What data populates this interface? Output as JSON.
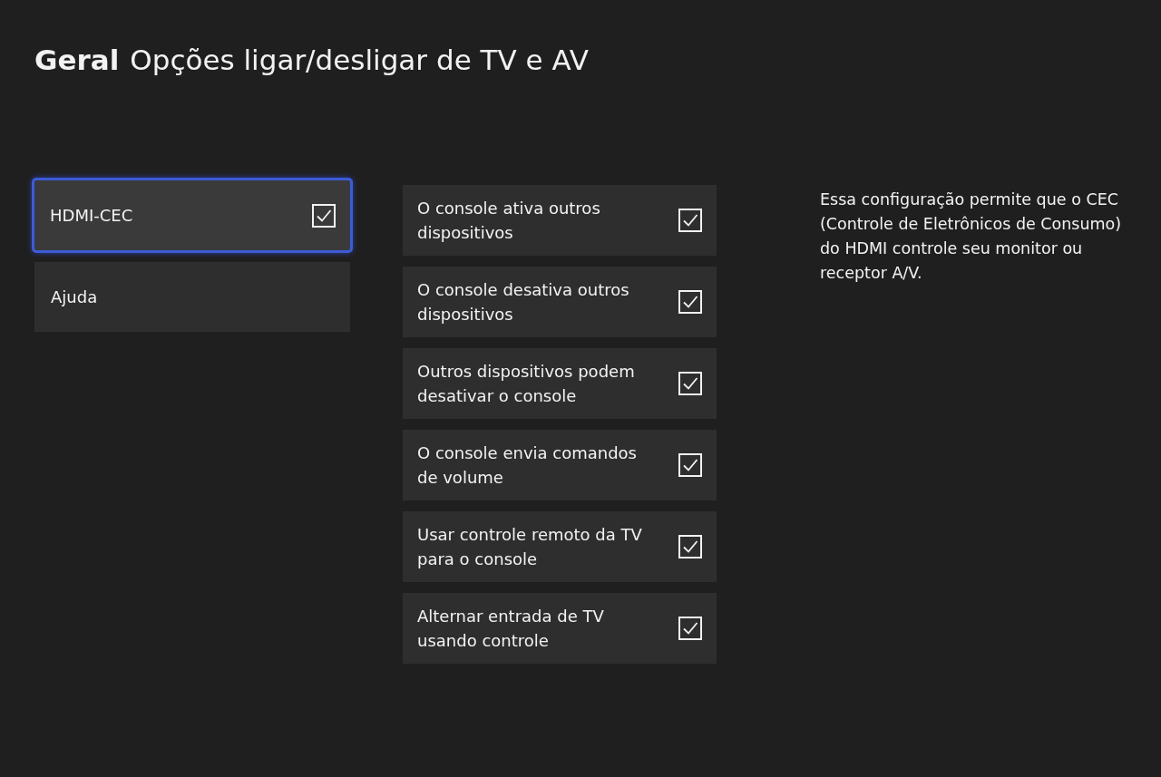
{
  "header": {
    "section": "Geral",
    "title": "Opções ligar/desligar de TV e AV"
  },
  "menu": [
    {
      "label": "HDMI-CEC",
      "kind": "checkbox",
      "checked": true,
      "selected": true
    },
    {
      "label": "Ajuda",
      "kind": "link",
      "selected": false
    }
  ],
  "options": [
    {
      "label": "O console ativa outros dispositivos",
      "checked": true
    },
    {
      "label": "O console desativa outros dispositivos",
      "checked": true
    },
    {
      "label": "Outros dispositivos podem desativar o console",
      "checked": true
    },
    {
      "label": "O console envia comandos de volume",
      "checked": true
    },
    {
      "label": "Usar controle remoto da TV para o console",
      "checked": true
    },
    {
      "label": "Alternar entrada de TV usando controle",
      "checked": true
    }
  ],
  "description": "Essa configuração permite que o CEC (Controle de Eletrônicos de Consumo) do HDMI controle seu monitor ou receptor A/V."
}
